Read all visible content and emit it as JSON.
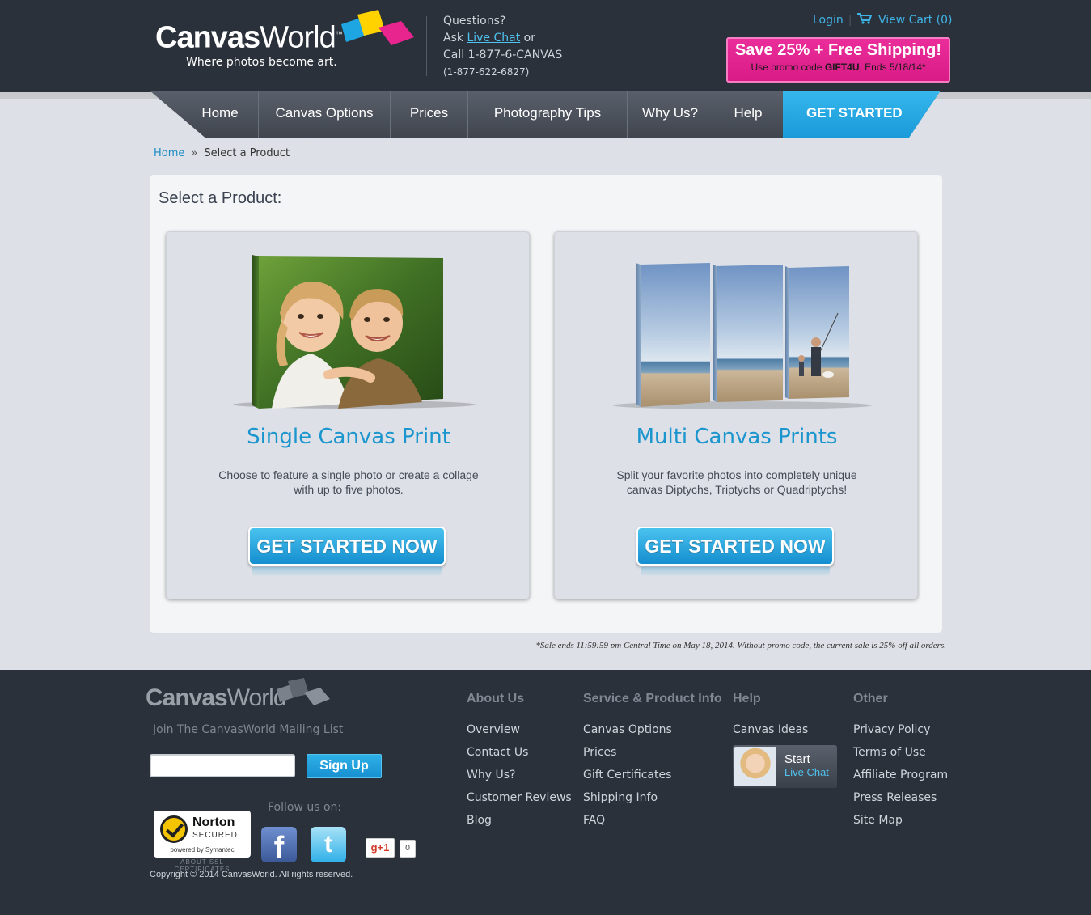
{
  "header": {
    "logo_primary": "Canvas",
    "logo_secondary": "World",
    "logo_tm": "™",
    "tagline": "Where photos become art.",
    "contact": {
      "line1": "Questions?",
      "ask_prefix": "Ask ",
      "live_chat": "Live Chat",
      "ask_suffix": " or",
      "call": "Call 1-877-6-CANVAS",
      "phone": "(1-877-622-6827)"
    },
    "login": "Login",
    "view_cart": "View Cart (0)",
    "promo": {
      "title": "Save 25% + Free Shipping!",
      "sub_prefix": "Use promo code ",
      "code": "GIFT4U",
      "sub_suffix": ", Ends 5/18/14*"
    }
  },
  "nav": {
    "items": [
      {
        "label": "Home"
      },
      {
        "label": "Canvas Options"
      },
      {
        "label": "Prices"
      },
      {
        "label": "Photography Tips"
      },
      {
        "label": "Why Us?"
      },
      {
        "label": "Help"
      }
    ],
    "cta": "GET STARTED"
  },
  "breadcrumb": {
    "home": "Home",
    "separator": "»",
    "current": "Select a Product"
  },
  "main": {
    "title": "Select a Product:",
    "cards": [
      {
        "title": "Single Canvas Print",
        "description": "Choose to feature a single photo or create a collage with up to five photos.",
        "button": "GET STARTED NOW"
      },
      {
        "title": "Multi Canvas Prints",
        "description": "Split your favorite photos into completely unique canvas Diptychs, Triptychs or Quadriptychs!",
        "button": "GET STARTED NOW"
      }
    ],
    "disclaimer": "*Sale ends 11:59:59 pm Central Time on May 18, 2014. Without promo code, the current sale is 25% off all orders."
  },
  "footer": {
    "logo_primary": "Canvas",
    "logo_secondary": "World",
    "mailing_list": "Join The CanvasWorld Mailing List",
    "email_placeholder": "",
    "signup": "Sign Up",
    "follow": "Follow us on:",
    "norton": {
      "name": "Norton",
      "secured": "SECURED",
      "powered": "powered by Symantec",
      "about": "ABOUT SSL CERTIFICATES"
    },
    "facebook": "f",
    "twitter": "t",
    "gplus": "g+1",
    "gplus_count": "0",
    "copyright": "Copyright © 2014 CanvasWorld. All rights reserved.",
    "columns": [
      {
        "heading": "About Us",
        "links": [
          "Overview",
          "Contact Us",
          "Why Us?",
          "Customer Reviews",
          "Blog"
        ]
      },
      {
        "heading": "Service & Product Info",
        "links": [
          "Canvas Options",
          "Prices",
          "Gift Certificates",
          "Shipping Info",
          "FAQ"
        ]
      },
      {
        "heading": "Help",
        "links": [
          "Canvas Ideas"
        ]
      },
      {
        "heading": "Other",
        "links": [
          "Privacy Policy",
          "Terms of Use",
          "Affiliate Program",
          "Press Releases",
          "Site Map"
        ]
      }
    ],
    "chat": {
      "start": "Start",
      "link": "Live Chat"
    }
  },
  "colors": {
    "header_bg": "#2b313b",
    "accent_blue": "#1b95ce",
    "promo_pink": "#e02590",
    "page_bg": "#dde0e6"
  }
}
